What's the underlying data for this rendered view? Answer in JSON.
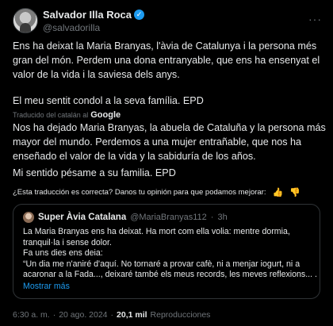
{
  "author": {
    "name": "Salvador Illa Roca",
    "handle": "@salvadorilla"
  },
  "tweet": {
    "paragraph1": "Ens ha deixat la Maria Branyas, l'àvia de Catalunya i la persona més gran del món. Perdem una dona entranyable, que ens ha ensenyat el valor de la vida i la saviesa dels anys.",
    "paragraph2": "El meu sentit condol a la seva família. EPD"
  },
  "translation": {
    "translated_by": "Traducido del catalán al",
    "provider": "Google",
    "paragraph1": "Nos ha dejado Maria Branyas, la abuela de Cataluña y la persona más mayor del mundo. Perdemos a una mujer entrañable, que nos ha enseñado el valor de la vida y la sabiduría de los años.",
    "paragraph2": "Mi sentido pésame a su familia. EPD",
    "feedback_question": "¿Esta traducción es correcta? Danos tu opinión para que podamos mejorar:"
  },
  "quoted": {
    "name": "Super Àvia Catalana",
    "handle": "@MariaBranyas112",
    "separator": "·",
    "time": "3h",
    "line1": "La Maria Branyas ens ha deixat. Ha mort com ella volia: mentre dormia,",
    "line2": "tranquil·la i sense dolor.",
    "line3": "Fa uns dies ens deia:",
    "line4": "“Un dia me n'aniré d'aquí. No tornaré a provar cafè, ni a menjar iogurt, ni a",
    "line5": "acaronar a la Fada..., deixaré també els meus records, les meves reflexions... ...",
    "show_more": "Mostrar más"
  },
  "meta": {
    "time": "6:30 a. m.",
    "separator": "·",
    "date": "20 ago. 2024",
    "views": "20,1 mil",
    "views_label": "Reproducciones"
  },
  "colors": {
    "background": "#000000",
    "text": "#e7e9ea",
    "muted": "#71767b",
    "accent": "#1d9bf0",
    "border": "#2f3336"
  },
  "icons": {
    "verified": "verified-badge-icon",
    "more": "more-dots-icon",
    "thumbs_up": "thumbs-up-icon",
    "thumbs_down": "thumbs-down-icon"
  }
}
